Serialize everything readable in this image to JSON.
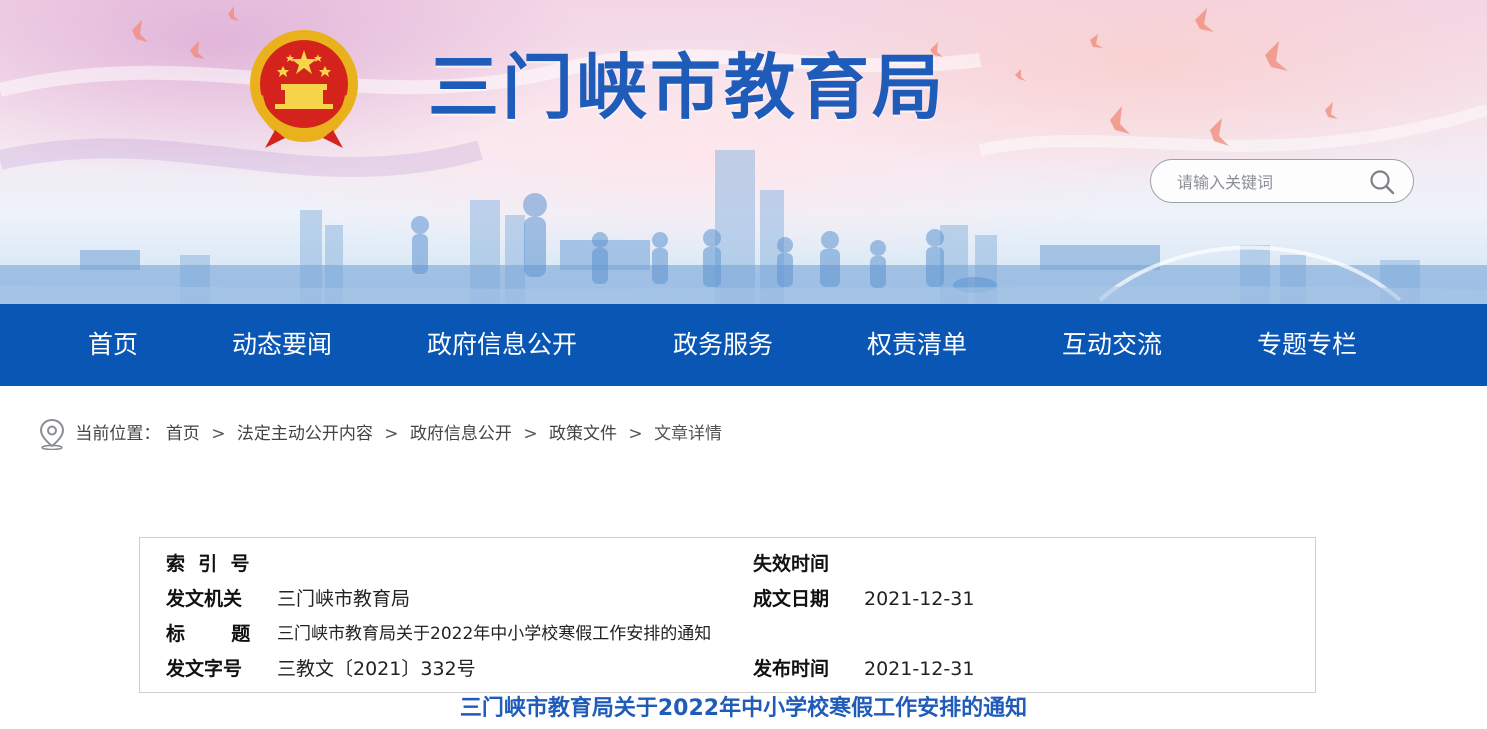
{
  "header": {
    "site_title": "三门峡市教育局",
    "search_placeholder": "请输入关键词"
  },
  "nav": {
    "items": [
      {
        "label": "首页"
      },
      {
        "label": "动态要闻"
      },
      {
        "label": "政府信息公开"
      },
      {
        "label": "政务服务"
      },
      {
        "label": "权责清单"
      },
      {
        "label": "互动交流"
      },
      {
        "label": "专题专栏"
      }
    ]
  },
  "breadcrumb": {
    "prefix": "当前位置：",
    "items": [
      {
        "label": "首页"
      },
      {
        "label": "法定主动公开内容"
      },
      {
        "label": "政府信息公开"
      },
      {
        "label": "政策文件"
      },
      {
        "label": "文章详情"
      }
    ],
    "separator": ">"
  },
  "info": {
    "index_label": "索  引  号",
    "index_value": "",
    "expire_label": "失效时间",
    "expire_value": "",
    "issuer_label": "发文机关",
    "issuer_value": "三门峡市教育局",
    "written_label": "成文日期",
    "written_value": "2021-12-31",
    "title_label": "标       题",
    "title_value": "三门峡市教育局关于2022年中小学校寒假工作安排的通知",
    "docno_label": "发文字号",
    "docno_value": "三教文〔2021〕332号",
    "published_label": "发布时间",
    "published_value": "2021-12-31"
  },
  "article": {
    "title": "三门峡市教育局关于2022年中小学校寒假工作安排的通知"
  },
  "colors": {
    "nav_bg": "#0a56b4",
    "title_blue": "#1f5bb8"
  }
}
